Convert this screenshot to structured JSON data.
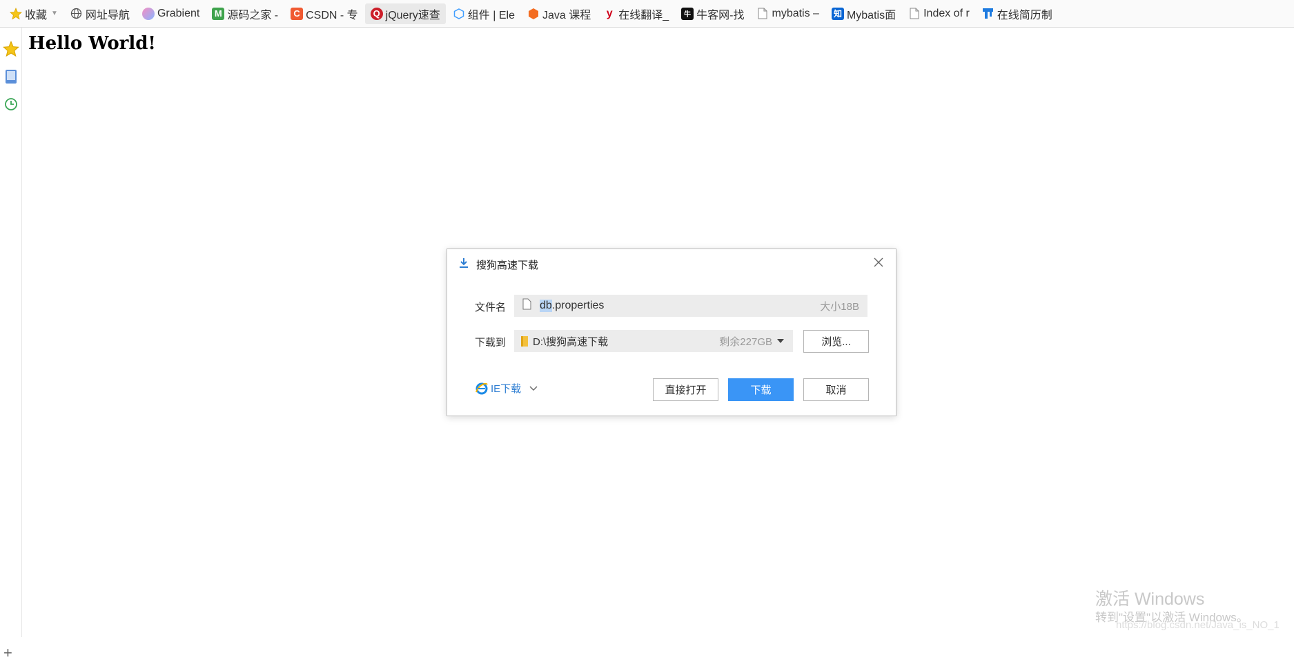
{
  "bookmarks": [
    {
      "label": "收藏",
      "icon": "star-icon"
    },
    {
      "label": "网址导航",
      "icon": "globe-icon"
    },
    {
      "label": "Grabient",
      "icon": "grabient-icon"
    },
    {
      "label": "源码之家 -",
      "icon": "m-logo-icon"
    },
    {
      "label": "CSDN - 专",
      "icon": "csdn-icon"
    },
    {
      "label": "jQuery速查",
      "icon": "jquery-icon"
    },
    {
      "label": "组件 | Ele",
      "icon": "element-icon"
    },
    {
      "label": "Java 课程",
      "icon": "java-course-icon"
    },
    {
      "label": "在线翻译_",
      "icon": "youdao-icon"
    },
    {
      "label": "牛客网-找",
      "icon": "nowcoder-icon"
    },
    {
      "label": "mybatis –",
      "icon": "page-icon"
    },
    {
      "label": "Mybatis面",
      "icon": "zhihu-icon"
    },
    {
      "label": "Index of r",
      "icon": "page-icon"
    },
    {
      "label": "在线简历制",
      "icon": "resume-icon"
    }
  ],
  "page": {
    "heading": "Hello World!"
  },
  "dialog": {
    "title": "搜狗高速下载",
    "filename_label": "文件名",
    "filename_selected": "db",
    "filename_rest": ".properties",
    "size_text": "大小18B",
    "saveto_label": "下载到",
    "directory": "D:\\搜狗高速下载",
    "free_space": "剩余227GB",
    "browse_label": "浏览...",
    "ie_download_label": "IE下载",
    "open_label": "直接打开",
    "download_label": "下载",
    "cancel_label": "取消"
  },
  "watermark": {
    "line1": "激活 Windows",
    "line2": "转到\"设置\"以激活 Windows。",
    "url": "https://blog.csdn.net/Java_is_NO_1"
  },
  "colors": {
    "primary_button": "#3a95f6",
    "link": "#2d7dd2"
  }
}
